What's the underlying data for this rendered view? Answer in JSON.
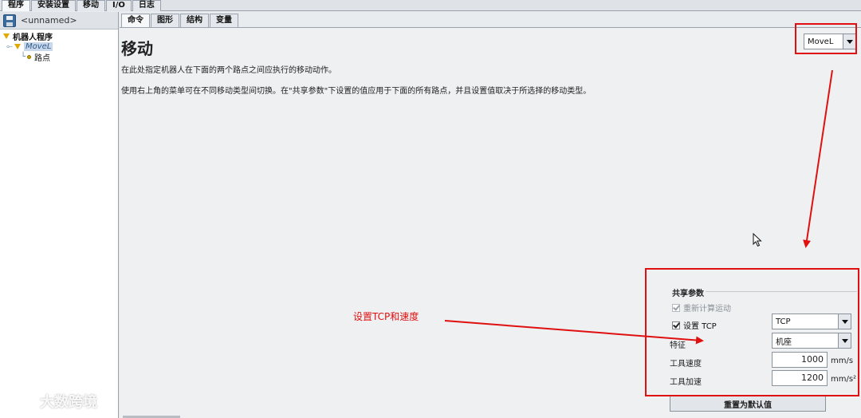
{
  "top_tabs": [
    {
      "label": "程序",
      "active": true
    },
    {
      "label": "安装设置",
      "active": false
    },
    {
      "label": "移动",
      "active": false
    },
    {
      "label": "I/O",
      "active": false
    },
    {
      "label": "日志",
      "active": false
    }
  ],
  "left_panel": {
    "program_name": "<unnamed>",
    "tree": {
      "root": "机器人程序",
      "node": "MoveL",
      "child": "路点"
    }
  },
  "sub_tabs": [
    {
      "label": "命令",
      "active": true
    },
    {
      "label": "图形",
      "active": false
    },
    {
      "label": "结构",
      "active": false
    },
    {
      "label": "变量",
      "active": false
    }
  ],
  "main": {
    "title": "移动",
    "description_1": "在此处指定机器人在下面的两个路点之间应执行的移动动作。",
    "description_2": "使用右上角的菜单可在不同移动类型间切换。在\"共享参数\"下设置的值应用于下面的所有路点，并且设置值取决于所选择的移动类型。",
    "move_type": "MoveL"
  },
  "shared_params": {
    "title": "共享参数",
    "recalc_label": "重新计算运动",
    "recalc_checked": true,
    "set_tcp_label": "设置 TCP",
    "set_tcp_checked": true,
    "tcp_value": "TCP",
    "feature_label": "特征",
    "feature_value": "机座",
    "tool_speed_label": "工具速度",
    "tool_speed_value": "1000",
    "tool_speed_unit": "mm/s",
    "tool_accel_label": "工具加速",
    "tool_accel_value": "1200",
    "tool_accel_unit": "mm/s²",
    "reset_label": "重置为默认值"
  },
  "annotation": {
    "text": "设置TCP和速度",
    "color": "#e01010"
  },
  "watermark": {
    "text": "大数跨境"
  }
}
